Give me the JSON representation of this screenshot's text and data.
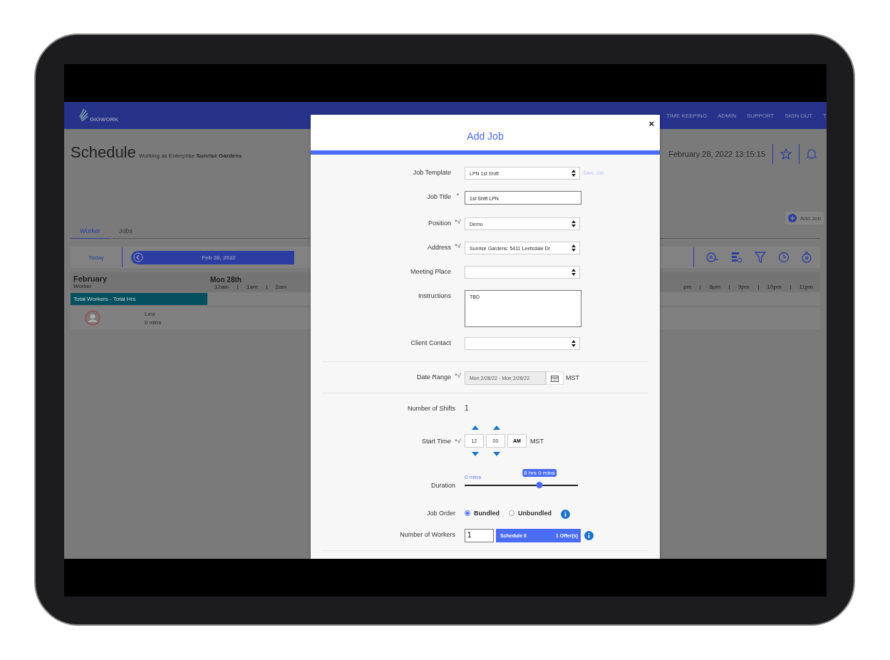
{
  "app": {
    "logo": "GIGWORK",
    "nav": [
      "TIME KEEPING",
      "ADMIN",
      "SUPPORT",
      "SIGN OUT",
      "T"
    ]
  },
  "header": {
    "title": "Schedule",
    "subtitle": "Working as Enterprise **Sunrise Gardens**",
    "datetime": "February 28, 2022 13:15:15",
    "add_job": "Add Job"
  },
  "tabs": [
    {
      "label": "Worker",
      "selected": true
    },
    {
      "label": "Jobs",
      "selected": false
    }
  ],
  "toolbar": {
    "today": "Today",
    "date": "Feb 28, 2022"
  },
  "grid": {
    "month": "February",
    "subheader": "Worker",
    "day": "Mon 28th",
    "hours_left": [
      "12am",
      "1am",
      "2am"
    ],
    "hours_right": [
      "pm",
      "8pm",
      "9pm",
      "10pm",
      "11pm"
    ],
    "total_row": "Total Workers - Total Hrs",
    "workers": [
      {
        "name": "Lew",
        "time": "0 mins"
      }
    ]
  },
  "modal": {
    "title": "Add Job",
    "close": "×",
    "fields": [
      {
        "label": "Job Template",
        "kind": "select",
        "value": "LPN 1st Shift",
        "link": "Save Job"
      },
      {
        "label": "Job Title",
        "marker": "*",
        "kind": "text",
        "value": "1st Shift  LPN"
      },
      {
        "label": "Position",
        "marker": "*√",
        "kind": "select",
        "value": "Demo"
      },
      {
        "label": "Address",
        "marker": "*√",
        "kind": "select",
        "value": "Sunrise Gardens: 5411 Leetsdale Dr"
      },
      {
        "label": "Meeting Place",
        "kind": "select"
      },
      {
        "label": "Instructions",
        "kind": "textarea",
        "value": "TBD"
      },
      {
        "label": "Client Contact",
        "kind": "select"
      }
    ],
    "date_range": {
      "label": "Date Range",
      "marker": "*√",
      "value": "Mon 2/28/22 - Mon 2/28/22",
      "zone": "MST"
    },
    "shifts": {
      "label": "Number of Shifts",
      "value": "1"
    },
    "start_time": {
      "label": "Start Time",
      "marker": "*√",
      "hour": "12",
      "minute": "00",
      "ampm": "AM",
      "zone": "MST"
    },
    "duration": {
      "label": "Duration",
      "min_label": "0 mins",
      "value_label": "8 hrs 0 mins",
      "level": 0.66
    },
    "job_order": {
      "label": "Job Order",
      "options": [
        {
          "label": "Bundled",
          "selected": true
        },
        {
          "label": "Unbundled",
          "selected": false
        }
      ]
    },
    "workers": {
      "label": "Number of Workers",
      "value": "1",
      "schedule": "Schedule 0",
      "offers": "1 Offer(s)"
    }
  }
}
